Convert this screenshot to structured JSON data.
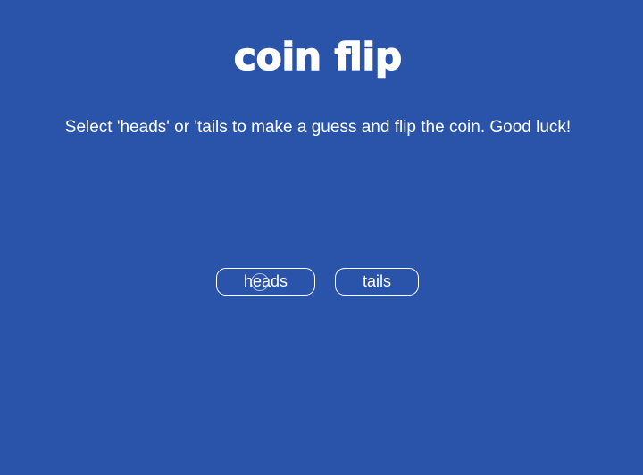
{
  "page": {
    "title": "coin flip",
    "instructions": "Select 'heads' or 'tails to make a guess and flip the coin. Good luck!"
  },
  "buttons": {
    "heads_label": "heads",
    "tails_label": "tails"
  },
  "colors": {
    "background": "#2a53aa",
    "foreground": "#ffffff"
  }
}
